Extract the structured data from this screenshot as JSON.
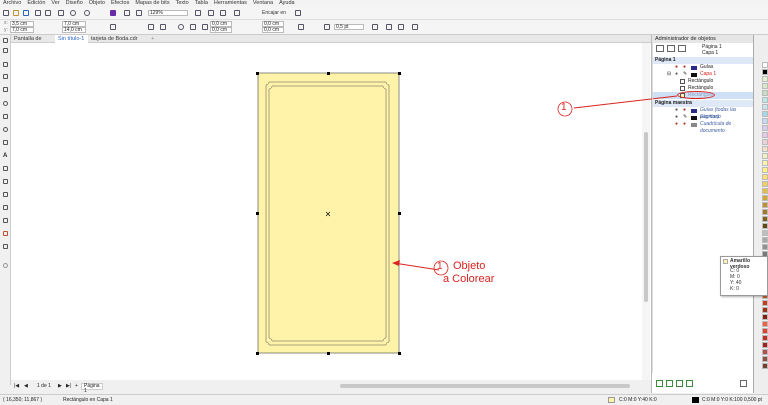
{
  "menu": [
    "Archivo",
    "Edición",
    "Ver",
    "Diseño",
    "Objeto",
    "Efectos",
    "Mapas de bits",
    "Texto",
    "Tabla",
    "Herramientas",
    "Ventana",
    "Ayuda"
  ],
  "toolbar": {
    "zoom_value": "129%",
    "snap_label": "Encajar en",
    "width_value": "7,0 cm",
    "height_value": "14,0 cm",
    "x_value": "3,5 cm",
    "y_value": "7,0 cm",
    "radius_1": "0,0 cm",
    "radius_2": "0,0 cm",
    "radius_3": "0,0 cm",
    "radius_4": "0,0 cm",
    "outline_width": "0,5 pt"
  },
  "tabs": [
    {
      "label": "Pantalla de inicio"
    },
    {
      "label": "Sin título-1"
    },
    {
      "label": "tarjeta de Boda.cdr"
    }
  ],
  "page_nav": {
    "page_text": "1 de 1",
    "page_tab": "Página 1"
  },
  "status": {
    "coords": "( 16,350; 11,867 )",
    "selection": "Rectángulo en Capa 1",
    "fill_info": "C:0 M:0 Y:40 K:0",
    "outline_info": "C:0 M:0 Y:0 K:100  0,500 pt"
  },
  "panel": {
    "title": "Administrador de objetos",
    "current_page": "Página 1",
    "current_layer": "Capa 1",
    "tree": {
      "page1": "Página 1",
      "guides": "Guías",
      "layer1": "Capa 1",
      "rect1": "Rectángulo",
      "rect2": "Rectángulo",
      "rect3": "Rectángulo",
      "master": "Página maestra",
      "master_guides": "Guías (todas las páginas)",
      "desktop": "Escritorio",
      "grid": "Cuadrícula de documento"
    }
  },
  "tooltip": {
    "name": "Amarillo verdoso",
    "c": "C: 0",
    "m": "M: 0",
    "y": "Y: 40",
    "k": "K: 0"
  },
  "annotations": {
    "marker_canvas": "1",
    "label_line1": "Objeto",
    "label_line2": "a Colorear",
    "marker_panel": "1"
  },
  "colors": {
    "object_fill": "#fff3aa",
    "annotation_red": "#d9231f",
    "accent_blue": "#2a64c8"
  },
  "palette": [
    "#ffffff",
    "#000000",
    "#e5f0cc",
    "#d8e8c8",
    "#c8dcc0",
    "#b8e8e8",
    "#c8e4f0",
    "#a8d8e8",
    "#c8d8f0",
    "#d8ccf0",
    "#e8c8e8",
    "#f0d0d8",
    "#f4e0c8",
    "#f0f0c0",
    "#fff3aa",
    "#fff080",
    "#ffe070",
    "#f0d060",
    "#e8c040",
    "#d0a830",
    "#c09030",
    "#a07828",
    "#806020",
    "#604818",
    "#c0c0c0",
    "#a8a8a8",
    "#909090",
    "#787878",
    "#606060",
    "#484848",
    "#303030",
    "#f0a070",
    "#e08050",
    "#d06030",
    "#c04020",
    "#a03018",
    "#802010",
    "#f06040",
    "#e04030",
    "#c03028",
    "#a02020",
    "#b05050",
    "#905040",
    "#704030"
  ]
}
